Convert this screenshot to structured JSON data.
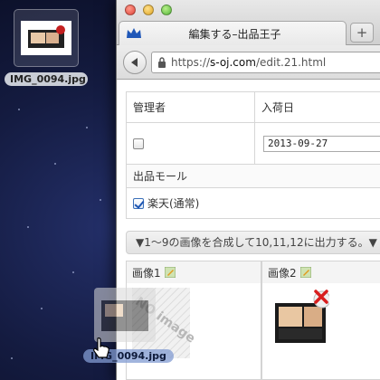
{
  "desktop": {
    "file_label": "IMG_0094.jpg"
  },
  "browser": {
    "tab_title": "編集する–出品王子",
    "new_tab_label": "+",
    "url_prefix": "https://",
    "url_host": "s-oj.com",
    "url_path": "/edit.21.html"
  },
  "form": {
    "col_admin": "管理者",
    "col_arrival": "入荷日",
    "arrival_date": "2013-09-27",
    "mall_heading": "出品モール",
    "mall_option": "楽天(通常)",
    "admin_checked": false,
    "mall_checked": true
  },
  "images": {
    "banner": "▼1〜9の画像を合成して10,11,12に出力する。▼",
    "image1_label": "画像1",
    "image2_label": "画像2",
    "no_image_text": "NO image"
  },
  "drag": {
    "label": "IMG_0094.jpg"
  }
}
